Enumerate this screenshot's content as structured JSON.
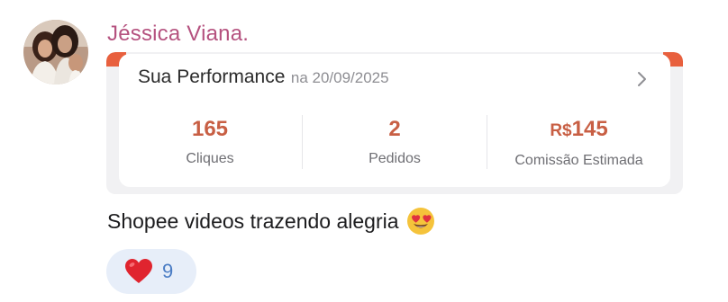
{
  "message": {
    "author": "Jéssica Viana.",
    "avatar_icon": "user-avatar",
    "text": "Shopee videos trazendo alegria",
    "emoji": "heart-eyes-emoji"
  },
  "performance_card": {
    "title": "Sua Performance",
    "date_text": "na 20/09/2025",
    "accent_color": "#e8603e",
    "value_color": "#c85f44",
    "stats": [
      {
        "value": "165",
        "label": "Cliques"
      },
      {
        "value": "2",
        "label": "Pedidos"
      },
      {
        "currency": "R$",
        "value": "145",
        "label": "Comissão Estimada"
      }
    ]
  },
  "reaction": {
    "icon": "heart-icon",
    "count": "9"
  }
}
